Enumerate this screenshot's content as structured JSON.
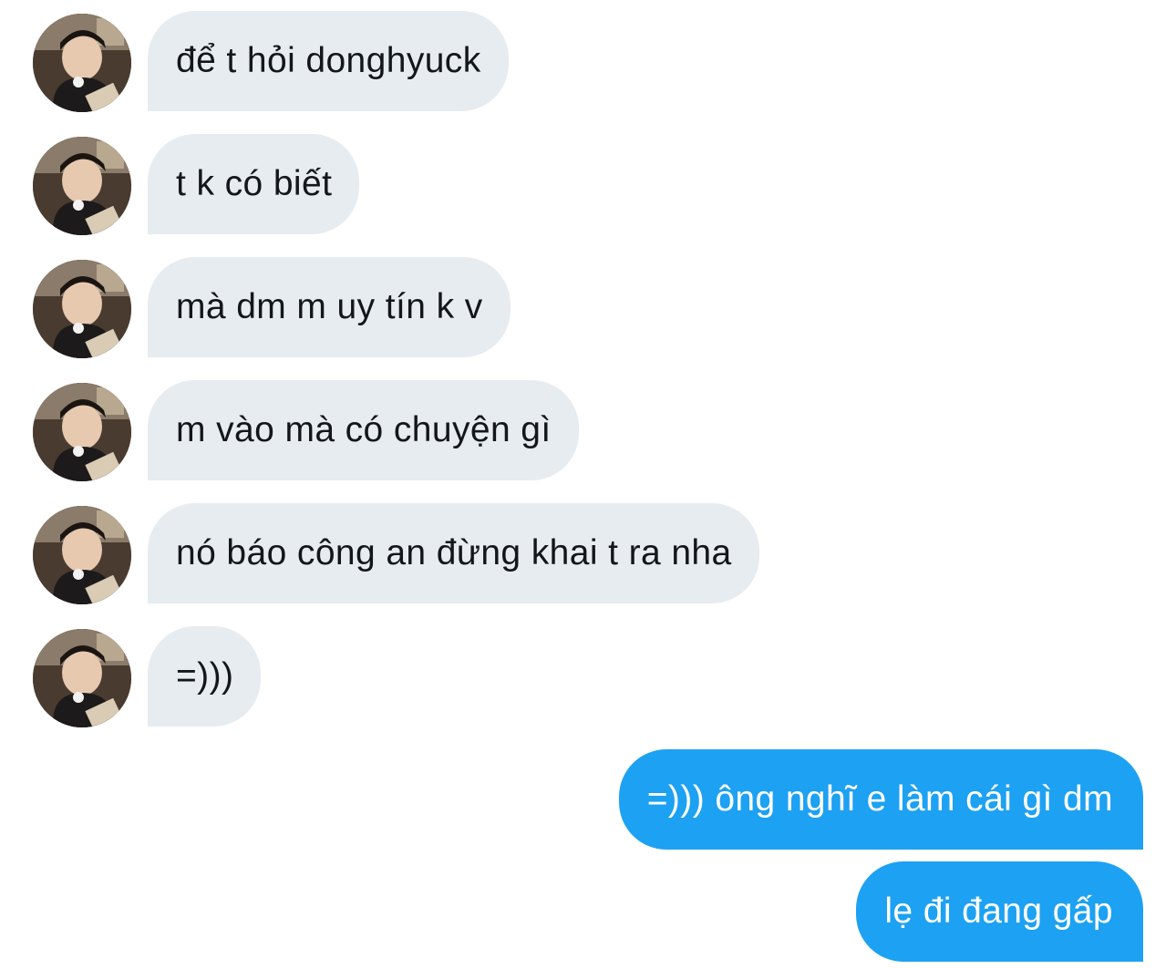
{
  "conversation": {
    "messages": [
      {
        "side": "in",
        "text": "để t hỏi donghyuck"
      },
      {
        "side": "in",
        "text": "t k có biết"
      },
      {
        "side": "in",
        "text": "mà dm m uy tín k v"
      },
      {
        "side": "in",
        "text": "m vào mà có chuyện gì"
      },
      {
        "side": "in",
        "text": "nó báo công an đừng khai t ra nha"
      },
      {
        "side": "in",
        "text": "=)))"
      },
      {
        "side": "out",
        "text": "=))) ông nghĩ e làm cái gì dm"
      },
      {
        "side": "out",
        "text": "lẹ đi đang gấp"
      }
    ]
  },
  "colors": {
    "incoming_bubble": "#e6ecf0",
    "incoming_text": "#14171a",
    "outgoing_bubble": "#1da1f2",
    "outgoing_text": "#ffffff",
    "background": "#ffffff"
  },
  "icons": {
    "sender_avatar": "avatar-photo"
  }
}
